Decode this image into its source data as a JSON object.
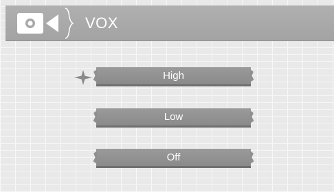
{
  "header": {
    "title": "VOX",
    "icon": "video-camera-icon"
  },
  "options": [
    {
      "label": "High",
      "selected": true
    },
    {
      "label": "Low",
      "selected": false
    },
    {
      "label": "Off",
      "selected": false
    }
  ],
  "selection_marker_icon": "four-point-star-icon",
  "colors": {
    "header_bg": "#a8a8a8",
    "button_bg": "#919191",
    "text": "#ffffff"
  }
}
